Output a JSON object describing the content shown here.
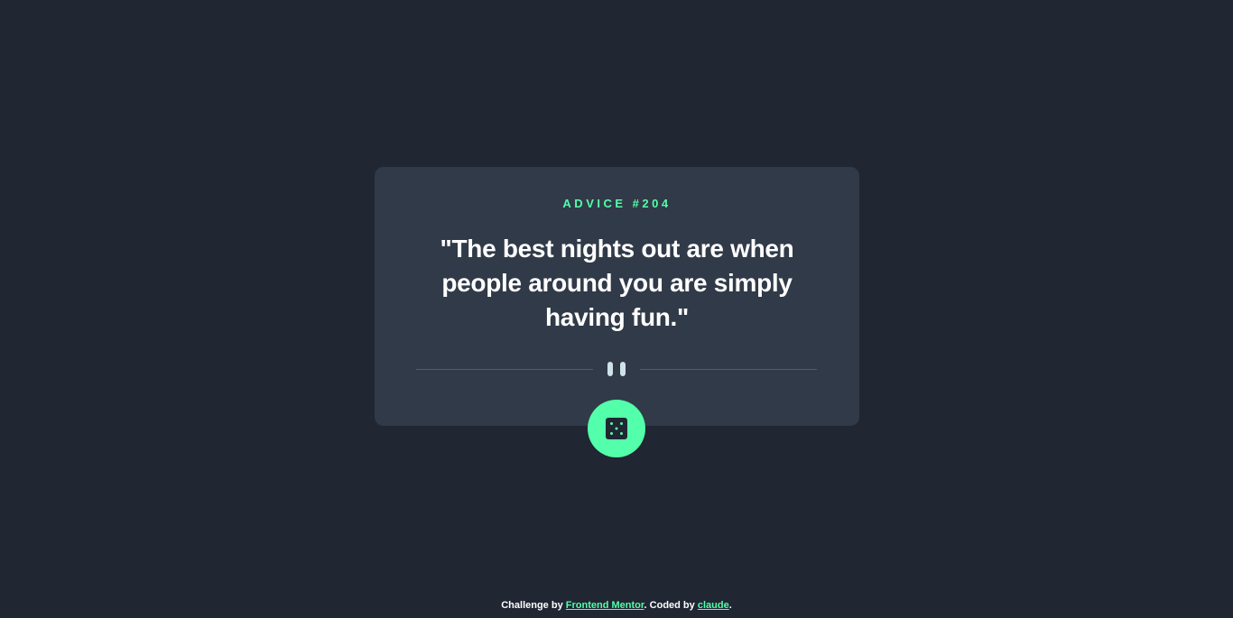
{
  "advice": {
    "id_label": "ADVICE #204",
    "quote": "\"The best nights out are when people around you are simply having fun.\""
  },
  "divider": {
    "icon": "pause-quote-icon"
  },
  "dice_button": {
    "icon": "dice-icon"
  },
  "footer": {
    "prefix": "Challenge by",
    "challenge_link": "Frontend Mentor",
    "middle": ". Coded by",
    "author_link": "claude",
    "suffix": "."
  },
  "colors": {
    "background": "#202632",
    "card": "#313a48",
    "accent": "#53ffaa",
    "text": "#ffffff",
    "divider": "#4f5d74"
  }
}
